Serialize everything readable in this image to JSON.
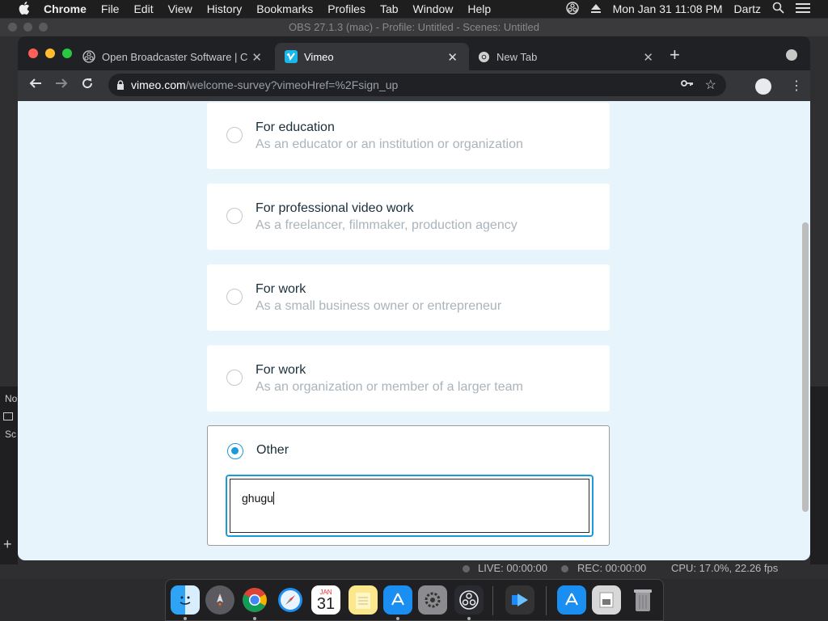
{
  "menubar": {
    "app": "Chrome",
    "items": [
      "File",
      "Edit",
      "View",
      "History",
      "Bookmarks",
      "Profiles",
      "Tab",
      "Window",
      "Help"
    ],
    "clock": "Mon Jan 31  11:08 PM",
    "user": "Dartz"
  },
  "obs": {
    "title": "OBS 27.1.3 (mac) - Profile: Untitled - Scenes: Untitled",
    "side_a": "No",
    "side_b": "Sc",
    "live": "LIVE: 00:00:00",
    "rec": "REC: 00:00:00",
    "cpu": "CPU: 17.0%, 22.26 fps"
  },
  "browser": {
    "tabs": [
      {
        "label": "Open Broadcaster Software | C",
        "icon": "obs-icon",
        "active": false
      },
      {
        "label": "Vimeo",
        "icon": "vimeo-icon",
        "active": true
      },
      {
        "label": "New Tab",
        "icon": "chrome-icon",
        "active": false
      }
    ],
    "url_host": "vimeo.com",
    "url_path": "/welcome-survey?vimeoHref=%2Fsign_up"
  },
  "survey": {
    "options": [
      {
        "title": "For education",
        "subtitle": "As an educator or an institution or organization",
        "selected": false
      },
      {
        "title": "For professional video work",
        "subtitle": "As a freelancer, filmmaker, production agency",
        "selected": false
      },
      {
        "title": "For work",
        "subtitle": "As a small business owner or entrepreneur",
        "selected": false
      },
      {
        "title": "For work",
        "subtitle": "As an organization or member of a larger team",
        "selected": false
      }
    ],
    "other": {
      "title": "Other",
      "selected": true,
      "value": "ghugu"
    }
  },
  "dock": {
    "apps": [
      "finder-icon",
      "launchpad-icon",
      "chrome-icon",
      "safari-icon",
      "calendar-icon",
      "notes-icon",
      "app-store-icon",
      "system-preferences-icon",
      "obs-icon",
      "screen-recorder-icon",
      "app-store-downloads-icon",
      "preview-icon",
      "trash-icon"
    ],
    "calendar_month": "JAN",
    "calendar_day": "31"
  },
  "colors": {
    "accent": "#1a9bd7",
    "page_bg": "#e8f4fc"
  }
}
